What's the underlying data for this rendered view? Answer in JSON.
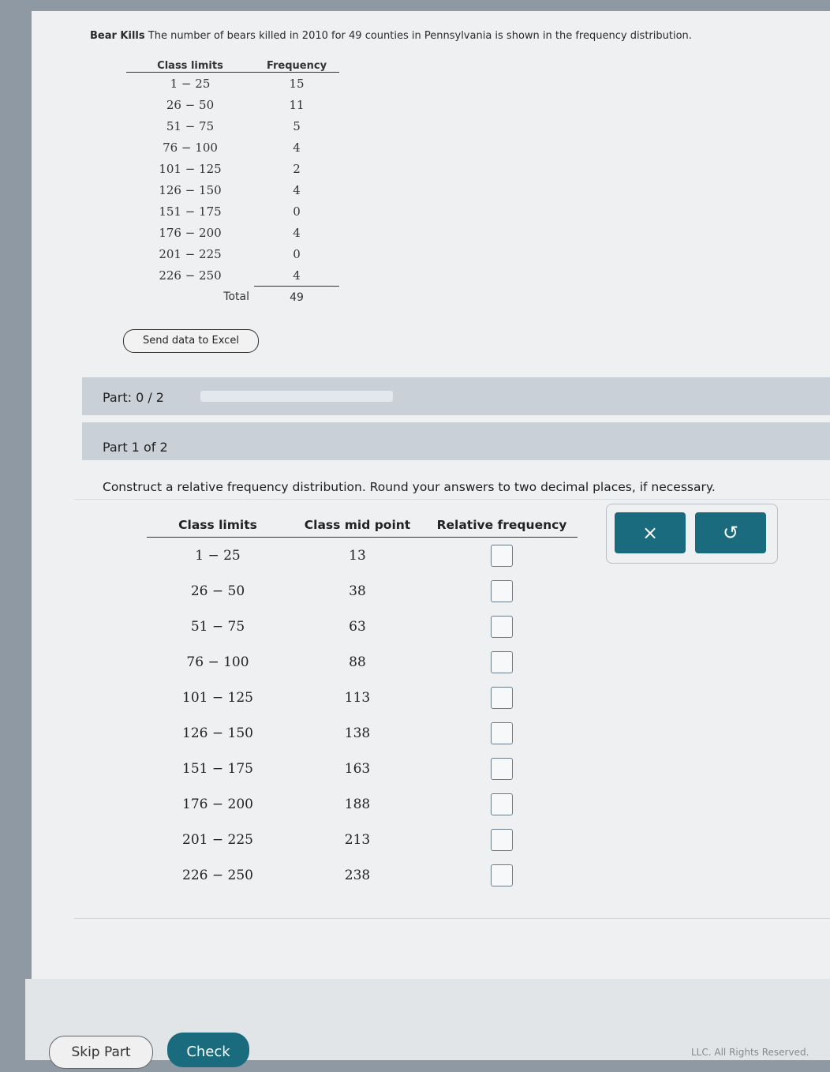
{
  "problem": {
    "title": "Bear Kills",
    "text": "The number of bears killed in 2010 for 49 counties in Pennsylvania is shown in the frequency distribution."
  },
  "freq_table": {
    "headers": [
      "Class limits",
      "Frequency"
    ],
    "rows": [
      {
        "limits": "1 − 25",
        "freq": "15"
      },
      {
        "limits": "26 − 50",
        "freq": "11"
      },
      {
        "limits": "51 − 75",
        "freq": "5"
      },
      {
        "limits": "76 − 100",
        "freq": "4"
      },
      {
        "limits": "101 − 125",
        "freq": "2"
      },
      {
        "limits": "126 − 150",
        "freq": "4"
      },
      {
        "limits": "151 − 175",
        "freq": "0"
      },
      {
        "limits": "176 − 200",
        "freq": "4"
      },
      {
        "limits": "201 − 225",
        "freq": "0"
      },
      {
        "limits": "226 − 250",
        "freq": "4"
      }
    ],
    "total_label": "Total",
    "total": "49"
  },
  "send_excel_label": "Send data to Excel",
  "part_progress": {
    "label": "Part: 0 / 2",
    "fraction": 0
  },
  "sub_part": {
    "label": "Part 1 of 2"
  },
  "instructions": "Construct a relative frequency distribution. Round your answers to two decimal places, if necessary.",
  "rel_table": {
    "headers": [
      "Class limits",
      "Class mid point",
      "Relative frequency"
    ],
    "rows": [
      {
        "limits": "1 − 25",
        "mid": "13",
        "value": ""
      },
      {
        "limits": "26 − 50",
        "mid": "38",
        "value": ""
      },
      {
        "limits": "51 − 75",
        "mid": "63",
        "value": ""
      },
      {
        "limits": "76 − 100",
        "mid": "88",
        "value": ""
      },
      {
        "limits": "101 − 125",
        "mid": "113",
        "value": ""
      },
      {
        "limits": "126 − 150",
        "mid": "138",
        "value": ""
      },
      {
        "limits": "151 − 175",
        "mid": "163",
        "value": ""
      },
      {
        "limits": "176 − 200",
        "mid": "188",
        "value": ""
      },
      {
        "limits": "201 − 225",
        "mid": "213",
        "value": ""
      },
      {
        "limits": "226 − 250",
        "mid": "238",
        "value": ""
      }
    ]
  },
  "tools": {
    "clear_symbol": "×",
    "undo_symbol": "↺"
  },
  "buttons": {
    "skip": "Skip Part",
    "check": "Check"
  },
  "footer": "LLC. All Rights Reserved."
}
